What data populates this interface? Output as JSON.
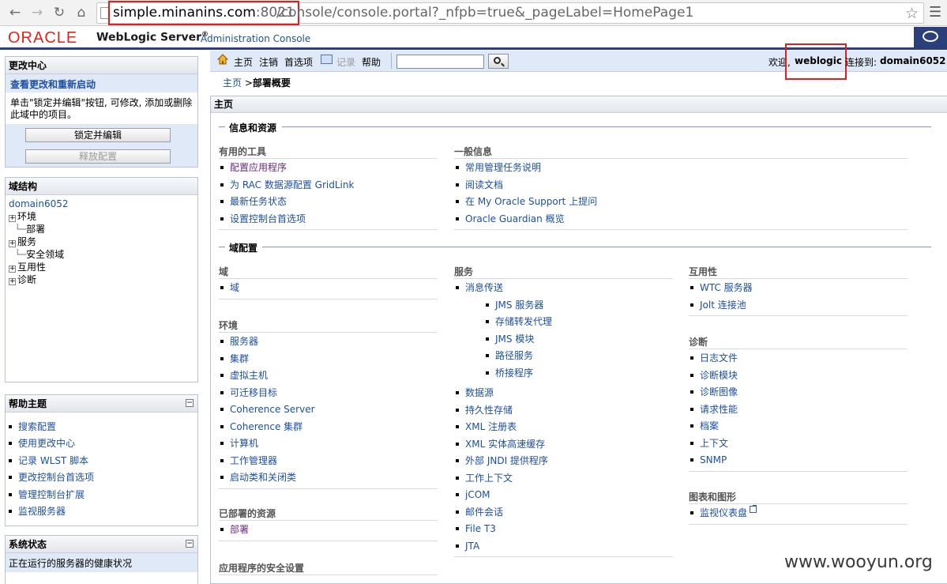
{
  "browser": {
    "url_host": "simple.minanins.com",
    "url_port": ":8021",
    "url_path": "/console/console.portal?_nfpb=true&_pageLabel=HomePage1"
  },
  "header": {
    "logo": "ORACLE",
    "product": "WebLogic Server",
    "product_reg": "®",
    "subtitle": "Administration Console"
  },
  "change_center": {
    "title": "更改中心",
    "subtitle": "查看更改和重新启动",
    "description": "单击\"锁定并编辑\"按钮, 可修改, 添加或删除此域中的项目。",
    "lock_button": "锁定并编辑",
    "release_button": "释放配置"
  },
  "domain_structure": {
    "title": "域结构",
    "root": "domain6052",
    "items": [
      {
        "label": "环境",
        "expandable": true
      },
      {
        "label": "部署",
        "expandable": false
      },
      {
        "label": "服务",
        "expandable": true
      },
      {
        "label": "安全领域",
        "expandable": false
      },
      {
        "label": "互用性",
        "expandable": true
      },
      {
        "label": "诊断",
        "expandable": true
      }
    ]
  },
  "help_topics": {
    "title": "帮助主题",
    "items": [
      "搜索配置",
      "使用更改中心",
      "记录 WLST 脚本",
      "更改控制台首选项",
      "管理控制台扩展",
      "监视服务器"
    ]
  },
  "system_status": {
    "title": "系统状态",
    "subtitle": "正在运行的服务器的健康状况"
  },
  "toolbar": {
    "home": "主页",
    "logout": "注销",
    "preferences": "首选项",
    "record": "记录",
    "help": "帮助",
    "search_value": "",
    "welcome": "欢迎,",
    "user": "weblogic",
    "connected": "连接到:",
    "domain": "domain6052"
  },
  "breadcrumb": {
    "home": "主页",
    "sep": ">",
    "current": "部署概要"
  },
  "main": {
    "title": "主页",
    "section1": "信息和资源",
    "section2": "域配置",
    "useful_tools": {
      "title": "有用的工具",
      "items": [
        "配置应用程序",
        "为 RAC 数据源配置 GridLink",
        "最新任务状态",
        "设置控制台首选项"
      ]
    },
    "general_info": {
      "title": "一般信息",
      "items": [
        "常用管理任务说明",
        "阅读文档",
        "在 My Oracle Support 上提问",
        "Oracle Guardian 概览"
      ]
    },
    "domain": {
      "title": "域",
      "items": [
        "域"
      ]
    },
    "environment": {
      "title": "环境",
      "items": [
        "服务器",
        "集群",
        "虚拟主机",
        "可迁移目标",
        "Coherence Server",
        "Coherence 集群",
        "计算机",
        "工作管理器",
        "启动类和关闭类"
      ]
    },
    "deployed": {
      "title": "已部署的资源",
      "items": [
        "部署"
      ]
    },
    "app_security": {
      "title": "应用程序的安全设置"
    },
    "services": {
      "title": "服务",
      "messaging": "消息传送",
      "messaging_sub": [
        "JMS 服务器",
        "存储转发代理",
        "JMS 模块",
        "路径服务",
        "桥接程序"
      ],
      "items": [
        "数据源",
        "持久性存储",
        "XML 注册表",
        "XML 实体高速缓存",
        "外部 JNDI 提供程序",
        "工作上下文",
        "jCOM",
        "邮件会话",
        "File T3",
        "JTA"
      ]
    },
    "interop": {
      "title": "互用性",
      "items": [
        "WTC 服务器",
        "Jolt 连接池"
      ]
    },
    "diagnostics": {
      "title": "诊断",
      "items": [
        "日志文件",
        "诊断模块",
        "诊断图像",
        "请求性能",
        "档案",
        "上下文",
        "SNMP"
      ]
    },
    "charts": {
      "title": "图表和图形",
      "items": [
        "监视仪表盘"
      ]
    }
  },
  "watermark": "www.wooyun.org",
  "colors": {
    "oracle_red": "#e2231a",
    "nav_blue": "#2b3f7a",
    "link_blue": "#1d4fa3",
    "toolbar_bg": "#dfe9f7",
    "highlight_red": "#e02020"
  }
}
